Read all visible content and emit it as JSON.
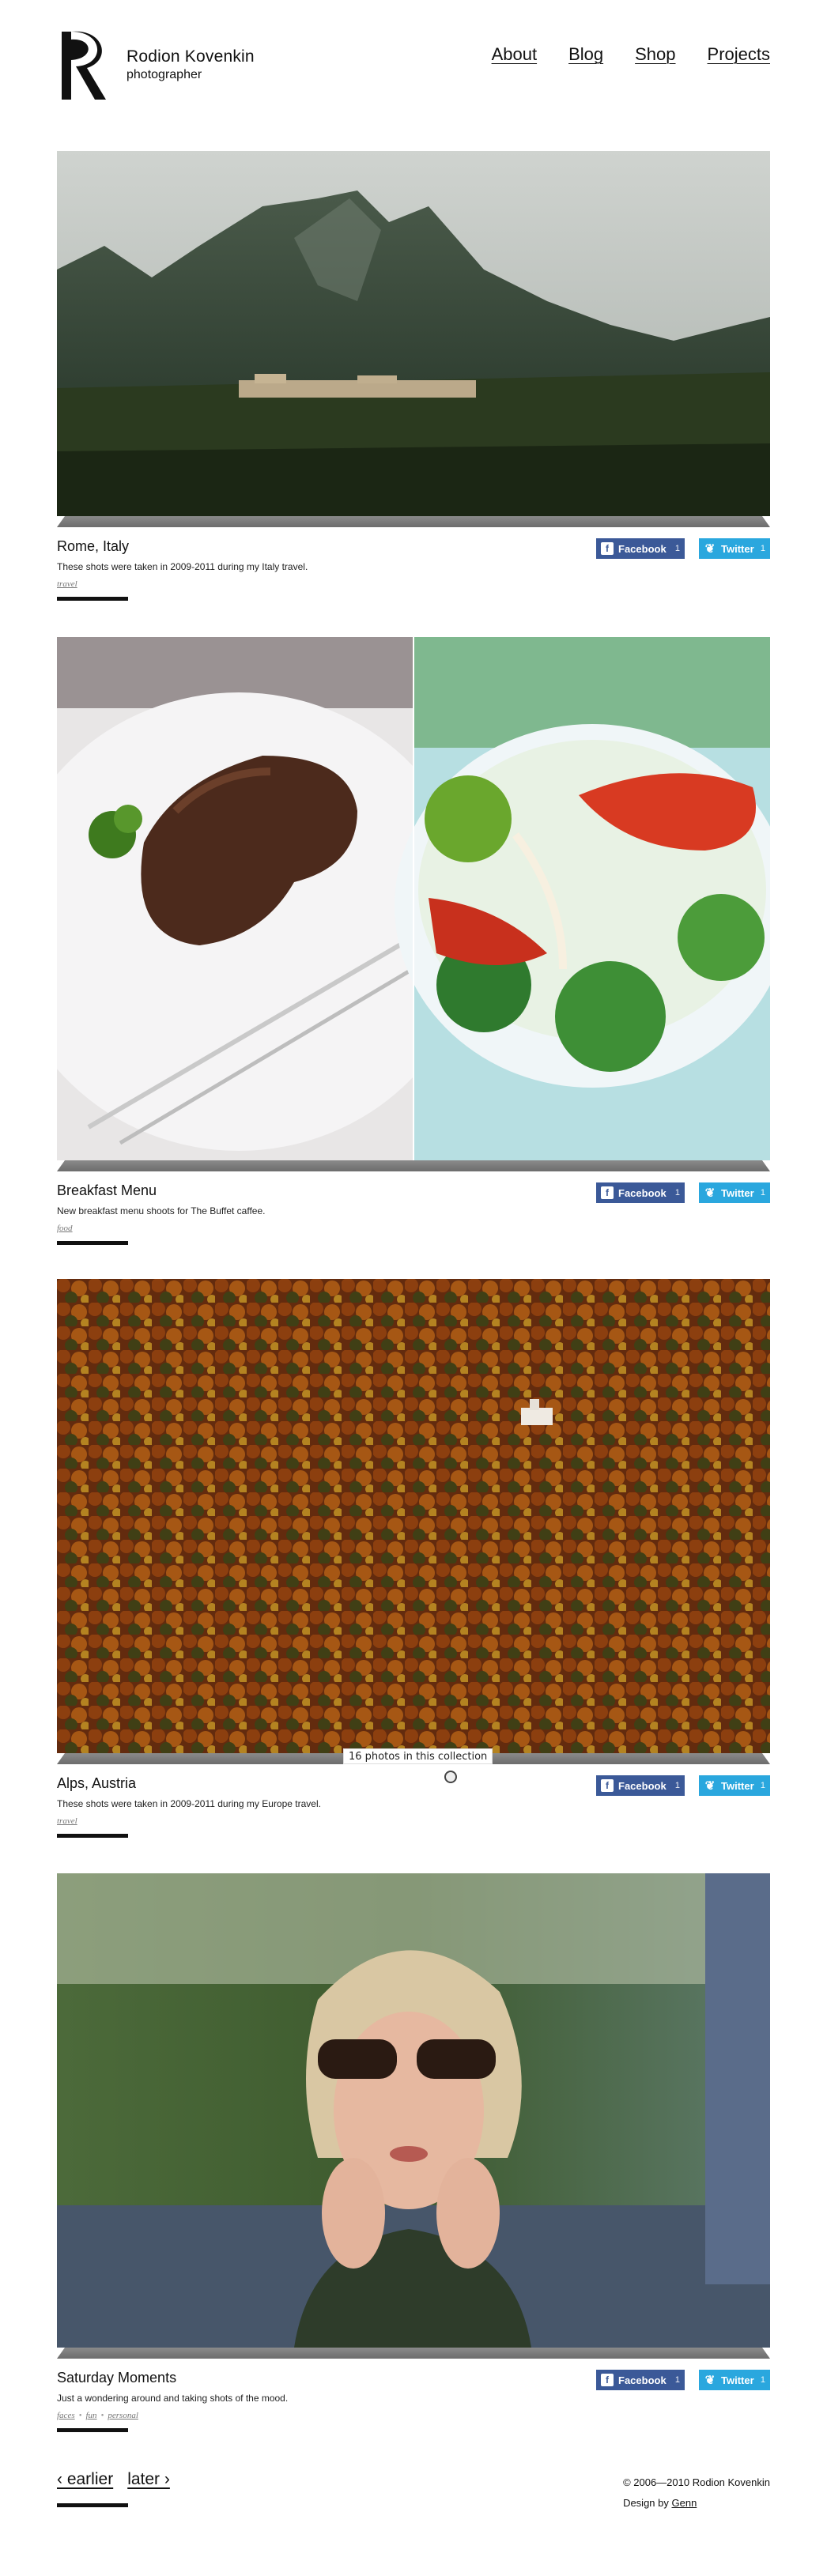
{
  "header": {
    "title": "Rodion Kovenkin",
    "subtitle": "photographer",
    "nav": [
      {
        "label": "About"
      },
      {
        "label": "Blog"
      },
      {
        "label": "Shop"
      },
      {
        "label": "Projects"
      }
    ]
  },
  "share": {
    "facebook_label": "Facebook",
    "twitter_label": "Twitter",
    "facebook_icon": "facebook-icon",
    "twitter_icon": "twitter-icon"
  },
  "posts": [
    {
      "title": "Rome, Italy",
      "description": "These shots were taken in 2009-2011 during my Italy travel.",
      "tags": [
        "travel"
      ],
      "facebook_count": "1",
      "twitter_count": "1"
    },
    {
      "title": "Breakfast Menu",
      "description": "New breakfast menu shoots for The Buffet caffee.",
      "tags": [
        "food"
      ],
      "facebook_count": "1",
      "twitter_count": "1"
    },
    {
      "title": "Alps, Austria",
      "description": "These shots were taken in 2009-2011 during my Europe travel.",
      "tags": [
        "travel"
      ],
      "facebook_count": "1",
      "twitter_count": "1",
      "collection_caption": "16 photos in this collection"
    },
    {
      "title": "Saturday Moments",
      "description": "Just a wondering around and taking shots of the mood.",
      "tags": [
        "faces",
        "fun",
        "personal"
      ],
      "facebook_count": "1",
      "twitter_count": "1"
    }
  ],
  "pager": {
    "earlier": "‹ earlier",
    "later": "later ›"
  },
  "footer": {
    "copyright": "© 2006—2010 Rodion Kovenkin",
    "design_prefix": "Design by",
    "design_link": "Genn"
  }
}
